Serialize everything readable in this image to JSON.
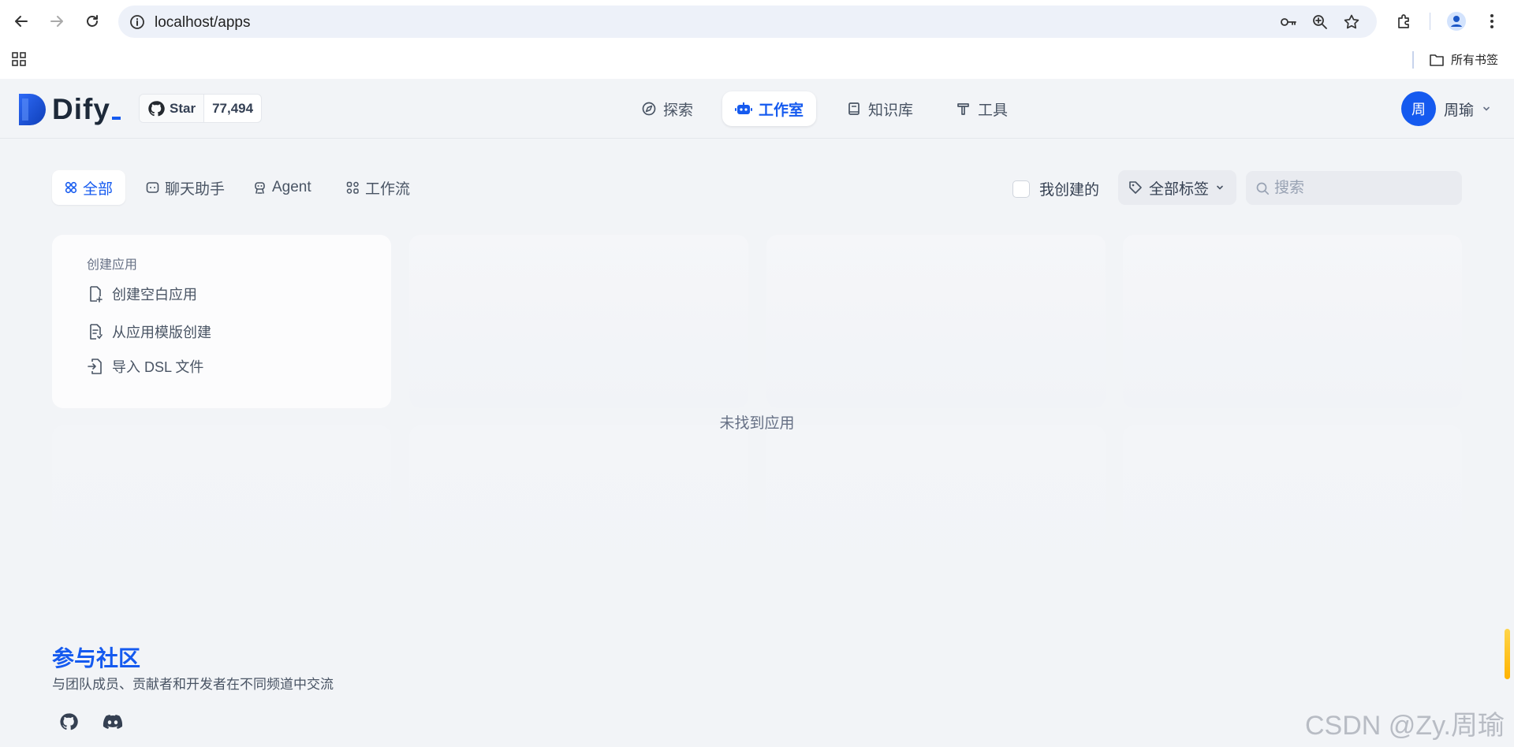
{
  "browser": {
    "url": "localhost/apps",
    "all_bookmarks": "所有书签"
  },
  "header": {
    "logo_text": "Dify",
    "github_star_label": "Star",
    "github_star_count": "77,494",
    "nav": [
      {
        "label": "探索",
        "icon": "compass-icon",
        "active": false
      },
      {
        "label": "工作室",
        "icon": "robot-icon",
        "active": true
      },
      {
        "label": "知识库",
        "icon": "book-icon",
        "active": false
      },
      {
        "label": "工具",
        "icon": "hammer-icon",
        "active": false
      }
    ],
    "user": {
      "avatar_char": "周",
      "name": "周瑜"
    }
  },
  "filters": {
    "tabs": [
      {
        "label": "全部",
        "icon": "grid-icon",
        "active": true
      },
      {
        "label": "聊天助手",
        "icon": "chat-bubble-icon",
        "active": false
      },
      {
        "label": "Agent",
        "icon": "agent-icon",
        "active": false
      },
      {
        "label": "工作流",
        "icon": "workflow-icon",
        "active": false
      }
    ],
    "created_by_me": "我创建的",
    "tag_select": "全部标签",
    "search_placeholder": "搜索"
  },
  "create_card": {
    "title": "创建应用",
    "items": [
      {
        "label": "创建空白应用",
        "icon": "file-plus-icon"
      },
      {
        "label": "从应用模版创建",
        "icon": "file-template-icon"
      },
      {
        "label": "导入 DSL 文件",
        "icon": "file-import-icon"
      }
    ]
  },
  "empty_message": "未找到应用",
  "footer": {
    "community_title": "参与社区",
    "community_desc": "与团队成员、贡献者和开发者在不同频道中交流"
  },
  "watermark": "CSDN @Zy.周瑜",
  "colors": {
    "accent": "#155aef",
    "background": "#f2f4f7"
  }
}
